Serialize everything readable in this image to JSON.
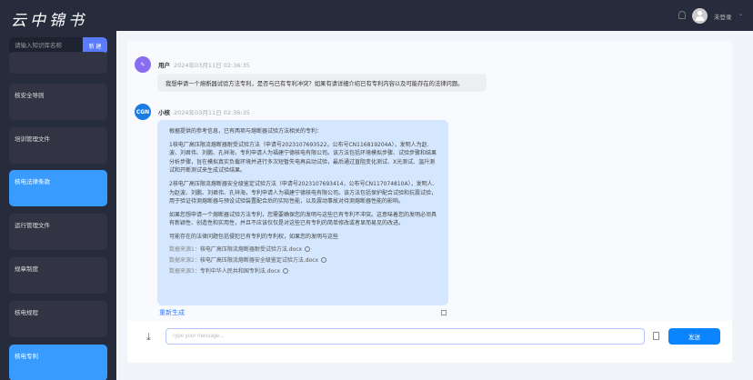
{
  "header": {
    "logo": "云中锦书",
    "user": "未登录",
    "caret": "⌄"
  },
  "sidebar": {
    "search_placeholder": "请输入知识库名称",
    "new_label": "新 建",
    "items": [
      {
        "label": ""
      },
      {
        "label": "核安全导则"
      },
      {
        "label": "培训管理文件"
      },
      {
        "label": "核电法律条款",
        "active": true
      },
      {
        "label": "运行管理文件"
      },
      {
        "label": "规章制度"
      },
      {
        "label": "核电规程"
      },
      {
        "label": "核电专利",
        "active": true
      }
    ]
  },
  "chat": {
    "user_msg": {
      "name": "用户",
      "time": "2024年03月11日 02:36:35",
      "text": "我想申请一个熔断器试验方法专利，是否与已有专利冲突？如果有请详细介绍已有专利内容以及可能存在的法律问题。"
    },
    "bot_msg": {
      "name": "小核",
      "avatar": "CGN",
      "time": "2024年03月11日 02:36:35",
      "paragraphs": [
        "根据提供的参考信息，已有两项与熔断器试验方法相关的专利：",
        "1核电厂高压限流熔断器耐受试验方法（申请号2023107693522，公布号CN116819204A），发明人为赵.波、刘君伟、刘鹏、孔祥海，专利申请人为福建宁德核电有限公司。该方法包括环境模拟步骤、试验步骤和结果分析步骤，旨在模拟真实负载环境并进行多次短暂失电再启动试验，最后通过直阻变化测试、X光测试、温升测试和开断测试来生成试验结果。",
        "2核电厂高压限流熔断器安全级鉴定试验方法（申请号2023107693414，公布号CN117074810A），发明人.为赵波、刘鹏、刘君伟、孔祥海，专利申请人为福建宁德核电有限公司。该方法包括保护配合试验和抗震试验，用于验证待测熔断器与预设试验装置配合后的实际性能，以及震动事故对待测熔断器性能的影响。",
        "如果您想申请一个熔断器试验方法专利，您需要确保您的发明与这些已有专利不冲突。这意味着您的发明必须具有新颖性、创造性和实用性，并且不应该仅仅是对这些已有专利的简单修改或者显而易见的改进。",
        "可能存在的法律问题包括侵犯已有专利的专利权，如果您的发明与这些"
      ],
      "sources": [
        {
          "label": "数据来源1：",
          "file": "核电厂高压限流熔断器耐受试验方法.docx"
        },
        {
          "label": "数据来源2：",
          "file": "核电厂高压限流熔断器安全级鉴定试验方法.docx"
        },
        {
          "label": "数据来源3：",
          "file": "专利中华人民共和国专利法.docx"
        }
      ],
      "regenerate": "重新生成"
    }
  },
  "input": {
    "placeholder": "Type your message...",
    "send_label": "发送"
  }
}
